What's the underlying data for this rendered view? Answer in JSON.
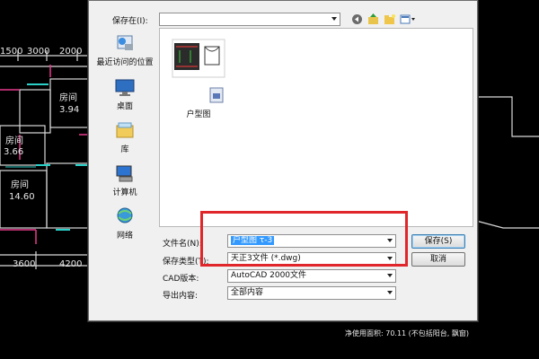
{
  "background_cad": {
    "dimensions_top": [
      "1500",
      "3000",
      "2000"
    ],
    "dimensions_bottom": [
      "3600",
      "4200"
    ],
    "rooms": [
      {
        "name": "房间",
        "value": "3.94"
      },
      {
        "name": "房间",
        "value": "3.66"
      },
      {
        "name": "房间",
        "value": "14.60"
      }
    ],
    "status_text": "净使用面积: 70.11 (不包括阳台, 飘窗)"
  },
  "dialog": {
    "save_in_label": "保存在(I):",
    "save_in_value": "",
    "places": [
      {
        "label": "最近访问的位置",
        "icon": "recent-places-icon"
      },
      {
        "label": "桌面",
        "icon": "desktop-icon"
      },
      {
        "label": "库",
        "icon": "library-icon"
      },
      {
        "label": "计算机",
        "icon": "computer-icon"
      },
      {
        "label": "网络",
        "icon": "network-icon"
      }
    ],
    "files": [
      {
        "name": "户型图",
        "icon": "dwg-file-icon"
      }
    ],
    "filename_label": "文件名(N):",
    "filename_value": "户型图 τ-3",
    "filetype_label": "保存类型(T):",
    "filetype_value": "天正3文件 (*.dwg)",
    "cad_version_label": "CAD版本:",
    "cad_version_value": "AutoCAD 2000文件",
    "export_label": "导出内容:",
    "export_value": "全部内容",
    "save_button": "保存(S)",
    "cancel_button": "取消"
  },
  "annotation": {
    "color": "#e0262a"
  }
}
